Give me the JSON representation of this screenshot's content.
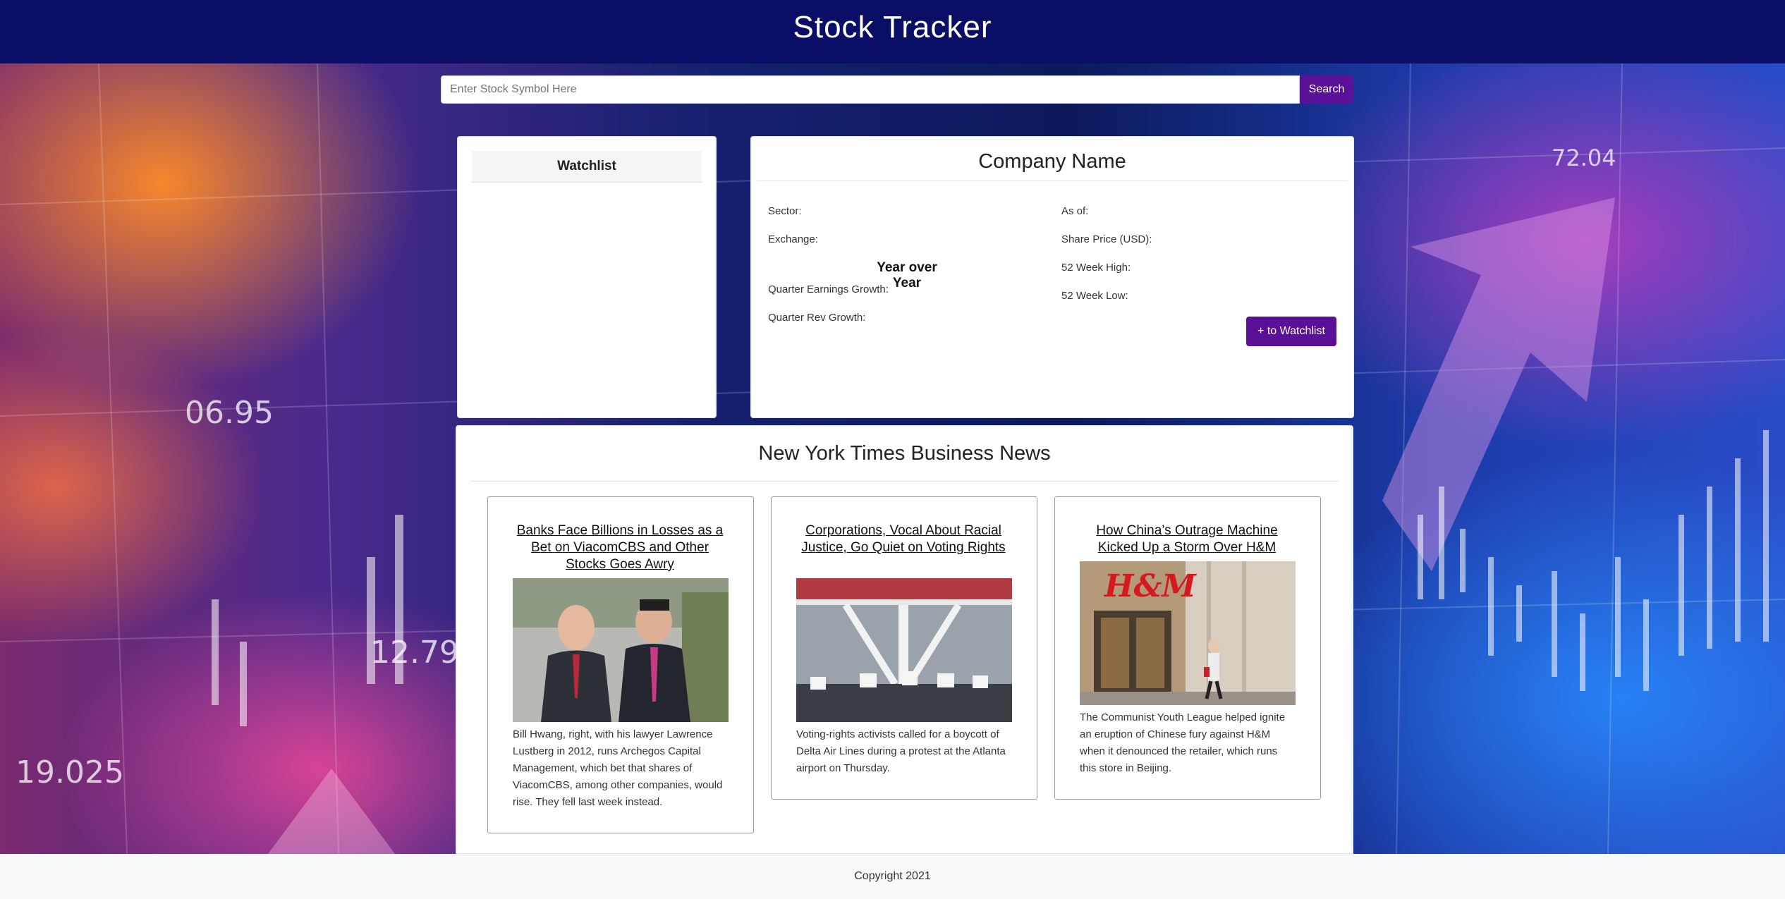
{
  "header": {
    "title": "Stock Tracker"
  },
  "background": {
    "numbers": [
      "06.95",
      "12.79",
      "19.025",
      "72.04"
    ]
  },
  "search": {
    "placeholder": "Enter Stock Symbol Here",
    "button_label": "Search"
  },
  "watchlist": {
    "title": "Watchlist"
  },
  "company": {
    "name": "Company Name",
    "sector_label": "Sector:",
    "exchange_label": "Exchange:",
    "yoy_heading": "Year over Year",
    "quarter_earnings_label": "Quarter Earnings Growth:",
    "quarter_rev_label": "Quarter Rev Growth:",
    "as_of_label": "As of:",
    "share_price_label": "Share Price (USD):",
    "week_high_label": "52 Week High:",
    "week_low_label": "52 Week Low:",
    "add_button_label": "+ to Watchlist"
  },
  "news": {
    "title": "New York Times Business News",
    "articles": [
      {
        "headline": "Banks Face Billions in Losses as a Bet on ViacomCBS and Other Stocks Goes Awry",
        "caption": "Bill Hwang, right, with his lawyer Lawrence Lustberg in 2012, runs Archegos Capital Management, which bet that shares of ViacomCBS, among other companies, would rise. They fell last week instead."
      },
      {
        "headline": "Corporations, Vocal About Racial Justice, Go Quiet on Voting Rights",
        "caption": "Voting-rights activists called for a boycott of Delta Air Lines during a protest at the Atlanta airport on Thursday."
      },
      {
        "headline": "How China’s Outrage Machine Kicked Up a Storm Over H&M",
        "caption": "The Communist Youth League helped ignite an eruption of Chinese fury against H&M when it denounced the retailer, which runs this store in Beijing.",
        "store_sign": "H&M"
      }
    ]
  },
  "footer": {
    "copyright": "Copyright 2021"
  }
}
